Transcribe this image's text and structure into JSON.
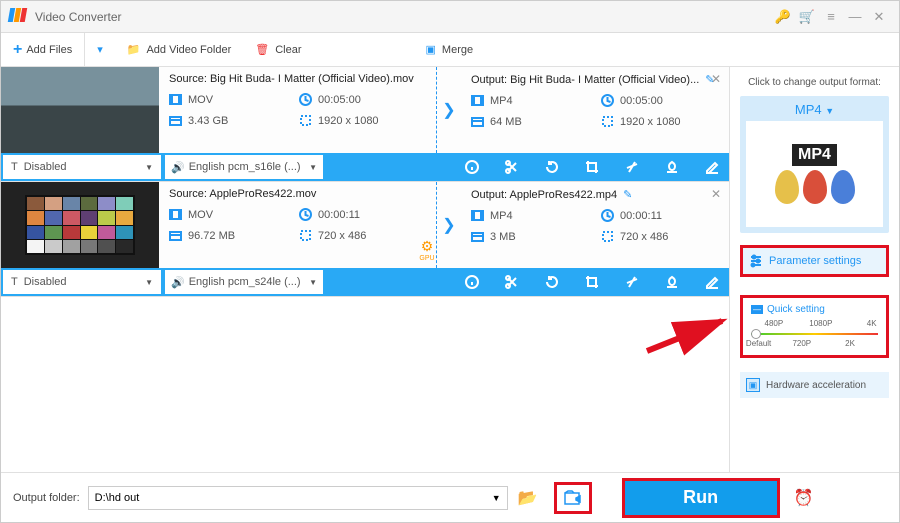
{
  "app": {
    "title": "Video Converter"
  },
  "toolbar": {
    "add_files": "Add Files",
    "add_folder": "Add Video Folder",
    "clear": "Clear",
    "merge": "Merge"
  },
  "items": [
    {
      "source_label": "Source: Big Hit Buda- I Matter (Official Video).mov",
      "src_format": "MOV",
      "src_dur": "00:05:00",
      "src_size": "3.43 GB",
      "src_res": "1920 x 1080",
      "output_label": "Output: Big Hit Buda- I Matter (Official Video)...",
      "out_format": "MP4",
      "out_dur": "00:05:00",
      "out_size": "64 MB",
      "out_res": "1920 x 1080",
      "subtitle": "Disabled",
      "audio": "English pcm_s16le (...)"
    },
    {
      "source_label": "Source: AppleProRes422.mov",
      "src_format": "MOV",
      "src_dur": "00:00:11",
      "src_size": "96.72 MB",
      "src_res": "720 x 486",
      "output_label": "Output: AppleProRes422.mp4",
      "out_format": "MP4",
      "out_dur": "00:00:11",
      "out_size": "3 MB",
      "out_res": "720 x 486",
      "subtitle": "Disabled",
      "audio": "English pcm_s24le (...)",
      "gpu_badge": "GPU"
    }
  ],
  "right": {
    "prompt": "Click to change output format:",
    "format": "MP4",
    "format_badge": "MP4",
    "param_settings": "Parameter settings",
    "quick_setting": "Quick setting",
    "scale": {
      "t1": "480P",
      "t2": "1080P",
      "t3": "4K",
      "b1": "Default",
      "b2": "720P",
      "b3": "2K"
    },
    "hwa": "Hardware acceleration"
  },
  "bottom": {
    "label": "Output folder:",
    "path": "D:\\hd out",
    "run": "Run"
  }
}
